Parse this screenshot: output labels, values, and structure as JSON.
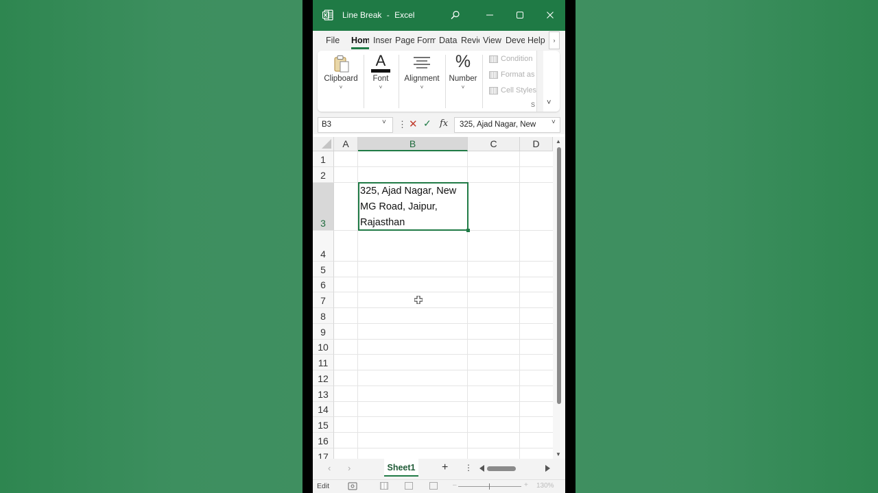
{
  "window": {
    "title": "Line Break",
    "separator": "-",
    "app_name": "Excel"
  },
  "menu": {
    "tabs": [
      {
        "label": "File"
      },
      {
        "label": "Hom",
        "active": true
      },
      {
        "label": "Inser"
      },
      {
        "label": "Page"
      },
      {
        "label": "Form"
      },
      {
        "label": "Data"
      },
      {
        "label": "Revie"
      },
      {
        "label": "View"
      },
      {
        "label": "Deve"
      },
      {
        "label": "Help"
      }
    ],
    "scroll_glyph": "›"
  },
  "ribbon": {
    "groups": [
      {
        "label": "Clipboard",
        "icon": "clipboard-icon"
      },
      {
        "label": "Font",
        "icon": "font-color-icon",
        "glyph": "A"
      },
      {
        "label": "Alignment",
        "icon": "align-icon"
      },
      {
        "label": "Number",
        "icon": "percent-icon",
        "glyph": "%"
      }
    ],
    "styles": {
      "items": [
        "Condition",
        "Format as",
        "Cell Styles"
      ],
      "group_label": "S"
    },
    "chevron_glyph": "˅"
  },
  "formula_bar": {
    "name_box": "B3",
    "cancel_glyph": "✕",
    "enter_glyph": "✓",
    "fx_label": "fx",
    "content": "325, Ajad Nagar, New"
  },
  "sheet": {
    "columns": [
      "A",
      "B",
      "C",
      "D"
    ],
    "selected_column": "B",
    "rows": [
      "1",
      "2",
      "3",
      "4",
      "5",
      "6",
      "7",
      "8",
      "9",
      "10",
      "11",
      "12",
      "13",
      "14",
      "15",
      "16",
      "17"
    ],
    "selected_row": "3",
    "active_cell": "B3",
    "active_cell_value": "325, Ajad Nagar, New\nMG Road, Jaipur,\nRajasthan"
  },
  "sheet_tabs": {
    "tabs": [
      "Sheet1"
    ],
    "add_glyph": "+",
    "menu_glyph": "⋮"
  },
  "status_bar": {
    "mode": "Edit",
    "zoom": "130%"
  },
  "colors": {
    "accent": "#1f7a45",
    "background": "#3d8f5f"
  }
}
